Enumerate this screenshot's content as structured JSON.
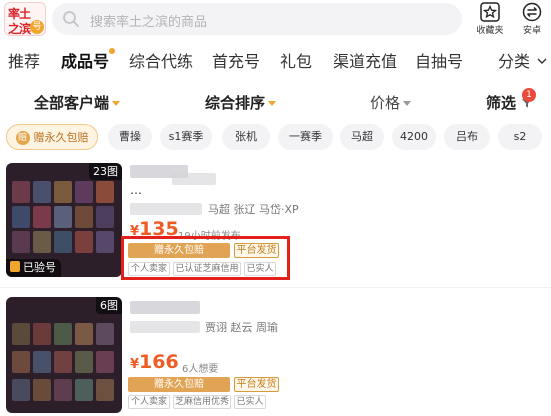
{
  "header": {
    "logo": {
      "line1": "率土",
      "line2": "之滨",
      "badge": "号"
    },
    "search_placeholder": "搜索率土之滨的商品",
    "favorites_label": "收藏夹",
    "android_label": "安卓"
  },
  "tabs": [
    {
      "label": "推荐",
      "active": false
    },
    {
      "label": "成品号",
      "active": true
    },
    {
      "label": "综合代练",
      "active": false
    },
    {
      "label": "首充号",
      "active": false
    },
    {
      "label": "礼包",
      "active": false
    },
    {
      "label": "渠道充值",
      "active": false
    },
    {
      "label": "自抽号",
      "active": false
    }
  ],
  "category_label": "分类",
  "filters": {
    "client": "全部客户端",
    "sort": "综合排序",
    "price": "价格",
    "screen": "筛选",
    "screen_badge": "1"
  },
  "chips": [
    "赠永久包赔",
    "曹操",
    "s1赛季",
    "张机",
    "一赛季",
    "马超",
    "4200",
    "吕布",
    "s2"
  ],
  "chip_icon_char": "赔",
  "listings": [
    {
      "image_count": "23图",
      "verified_label": "已验号",
      "title_suffix": "…",
      "heroes": "马超 张辽 马岱·XP",
      "price_symbol": "¥",
      "price": "135",
      "meta": "19小时前发布",
      "tag_main": "赠永久包赔",
      "tag_outline": "平台发货",
      "sub_tags": [
        "个人卖家",
        "已认证芝麻信用",
        "已实人"
      ],
      "highlighted": true
    },
    {
      "image_count": "6图",
      "verified_label": "",
      "title_suffix": "",
      "heroes": "贾诩 赵云 周瑜",
      "price_symbol": "¥",
      "price": "166",
      "meta": "6人想要",
      "tag_main": "赠永久包赔",
      "tag_outline": "平台发货",
      "sub_tags": [
        "个人卖家",
        "芝麻信用优秀",
        "已实人"
      ],
      "highlighted": false
    }
  ],
  "colors": {
    "accent_orange": "#ef5d25",
    "tag_gold": "#e1a354",
    "highlight_red": "#e2211c",
    "badge_red": "#e84a3c"
  }
}
